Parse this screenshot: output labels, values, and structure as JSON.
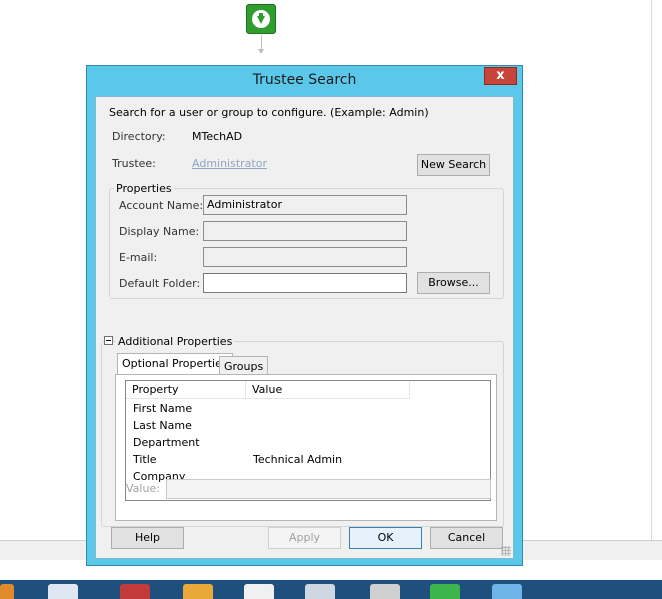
{
  "dialog": {
    "title": "Trustee Search",
    "close_glyph": "x",
    "instructions": "Search for a user or group to configure. (Example: Admin)",
    "directory_label": "Directory:",
    "directory_value": "MTechAD",
    "trustee_label": "Trustee:",
    "trustee_value": "Administrator",
    "new_search_label": "New Search"
  },
  "properties": {
    "title": "Properties",
    "account_name_label": "Account Name:",
    "account_name_value": "Administrator",
    "display_name_label": "Display Name:",
    "display_name_value": "",
    "email_label": "E-mail:",
    "email_value": "",
    "default_folder_label": "Default Folder:",
    "default_folder_value": "",
    "browse_label": "Browse..."
  },
  "additional": {
    "title": "Additional Properties",
    "tabs": [
      {
        "label": "Optional Properties",
        "active": true
      },
      {
        "label": "Groups",
        "active": false
      }
    ],
    "columns": [
      "Property",
      "Value"
    ],
    "rows": [
      {
        "property": "First Name",
        "value": ""
      },
      {
        "property": "Last Name",
        "value": ""
      },
      {
        "property": "Department",
        "value": ""
      },
      {
        "property": "Title",
        "value": "Technical Admin"
      },
      {
        "property": "Company",
        "value": ""
      }
    ],
    "value_label": "Value:",
    "value_field": ""
  },
  "buttons": {
    "help": "Help",
    "apply": "Apply",
    "ok": "OK",
    "cancel": "Cancel"
  },
  "colors": {
    "title_bar": "#5bc8ea",
    "close_button": "#c8443a",
    "workflow_node": "#2f9e2f",
    "taskbar": "#1f4f7c"
  },
  "icons": {
    "workflow_node": "download-arrow-icon",
    "close": "close-icon",
    "collapse": "collapse-minus-icon",
    "resize": "resize-grip-icon"
  }
}
